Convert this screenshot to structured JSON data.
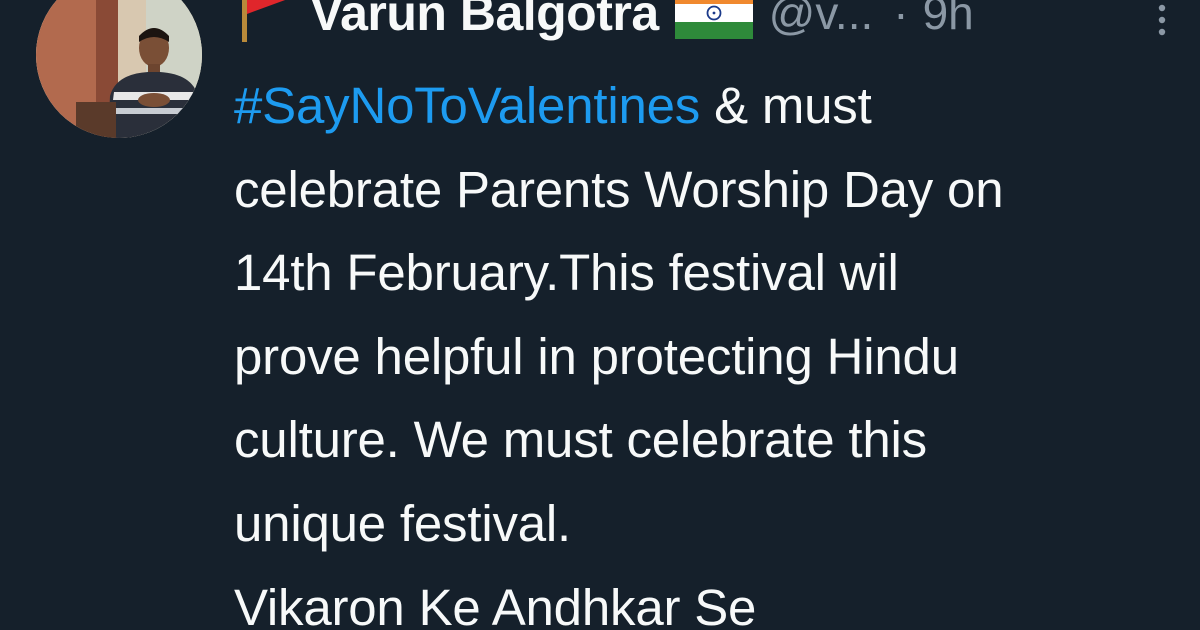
{
  "tweet": {
    "author_name": "Varun Balgotra",
    "handle": "@v...",
    "separator": "·",
    "timestamp": "9h",
    "icons": {
      "name_prefix": "red-flag-icon",
      "name_suffix": "india-flag-icon",
      "more": "more-options-icon"
    },
    "hashtag": "#SayNoToValentines",
    "after_hashtag": " & must",
    "lines": [
      "celebrate Parents Worship Day on",
      "14th February.This festival wil",
      "prove helpful in protecting Hindu",
      "culture. We must celebrate this",
      "unique festival.",
      "Vikaron Ke Andhkar Se"
    ]
  },
  "colors": {
    "background": "#15202b",
    "text": "#f7f9f9",
    "secondary": "#8b98a5",
    "link": "#1d9bf0"
  }
}
